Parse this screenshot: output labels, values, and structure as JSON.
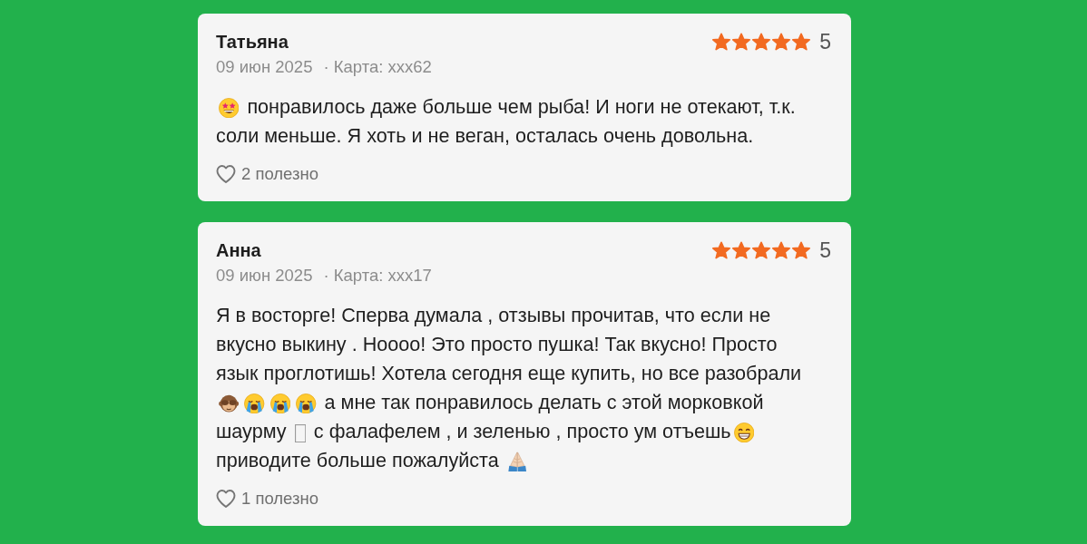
{
  "reviews": [
    {
      "author": "Татьяна",
      "stars": 5,
      "rating": "5",
      "date": "09 июн 2025",
      "card": "· Карта: xxx62",
      "body": [
        {
          "kind": "starstruck"
        },
        {
          "kind": "text",
          "text": " понравилось даже больше чем рыба! И ноги не отекают, т.к. "
        },
        {
          "kind": "text",
          "text": "соли меньше. Я хоть и не веган, осталась очень довольна."
        }
      ],
      "helpful": {
        "liked": false,
        "label": "2 полезно"
      }
    },
    {
      "author": "Анна",
      "stars": 5,
      "rating": "5",
      "date": "09 июн 2025",
      "card": "· Карта: xxx17",
      "body": [
        {
          "kind": "text",
          "text": "Я в восторге! Сперва думала , отзывы прочитав, что если не вкусно выкину . Ноооо! Это просто пушка! Так вкусно! Просто язык проглотишь! Хотела сегодня еще купить, но все разобрали "
        },
        {
          "kind": "monkey"
        },
        {
          "kind": "crying"
        },
        {
          "kind": "crying"
        },
        {
          "kind": "crying"
        },
        {
          "kind": "text",
          "text": " а мне так понравилось делать с этой морковкой "
        },
        {
          "kind": "text",
          "text": "шаурму "
        },
        {
          "kind": "tofu"
        },
        {
          "kind": "text",
          "text": " с фалафелем , и зеленью , просто ум отъешь"
        },
        {
          "kind": "grinning"
        },
        {
          "kind": "text",
          "text": " приводите больше пожалуйста "
        },
        {
          "kind": "pray"
        }
      ],
      "helpful": {
        "liked": false,
        "label": "1 полезно"
      }
    }
  ]
}
